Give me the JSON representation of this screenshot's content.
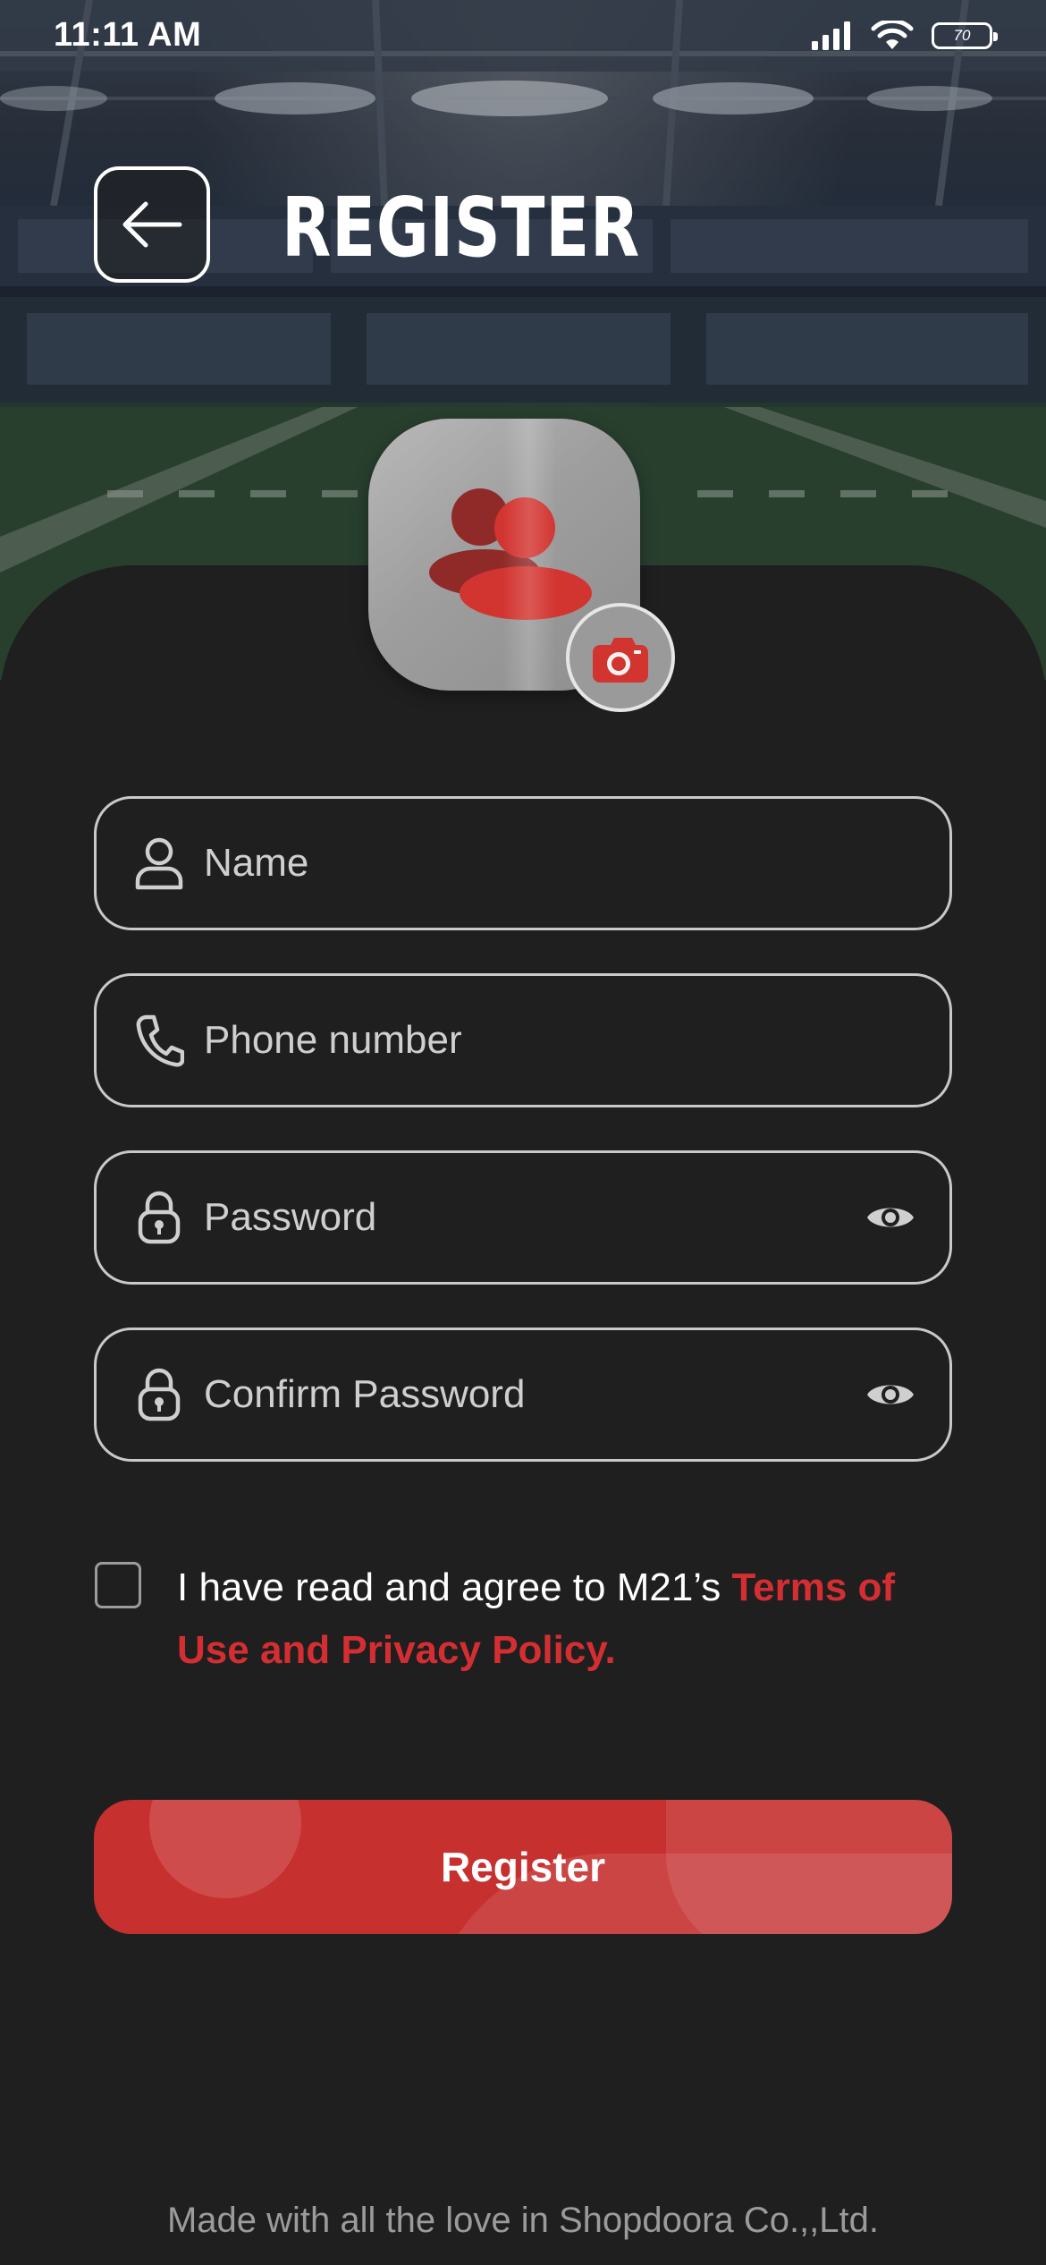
{
  "status_bar": {
    "time": "11:11 AM",
    "battery": "70"
  },
  "header": {
    "title": "REGISTER"
  },
  "avatar": {
    "icon": "users-icon",
    "camera_icon": "camera-icon"
  },
  "form": {
    "name": {
      "placeholder": "Name",
      "value": "",
      "icon": "user-icon"
    },
    "phone": {
      "placeholder": "Phone number",
      "value": "",
      "icon": "phone-icon"
    },
    "password": {
      "placeholder": "Password",
      "value": "",
      "icon": "lock-icon"
    },
    "confirm_password": {
      "placeholder": "Confirm Password",
      "value": "",
      "icon": "lock-icon"
    }
  },
  "terms": {
    "prefix": "I have read and agree to M21’s ",
    "link": "Terms of Use and Privacy Policy.",
    "checked": false
  },
  "register_button": {
    "label": "Register"
  },
  "footer": {
    "text": "Made with all the love in Shopdoora Co.,,Ltd."
  },
  "colors": {
    "accent": "#c6302f",
    "link": "#d42e33",
    "background": "#1f1f1f"
  }
}
